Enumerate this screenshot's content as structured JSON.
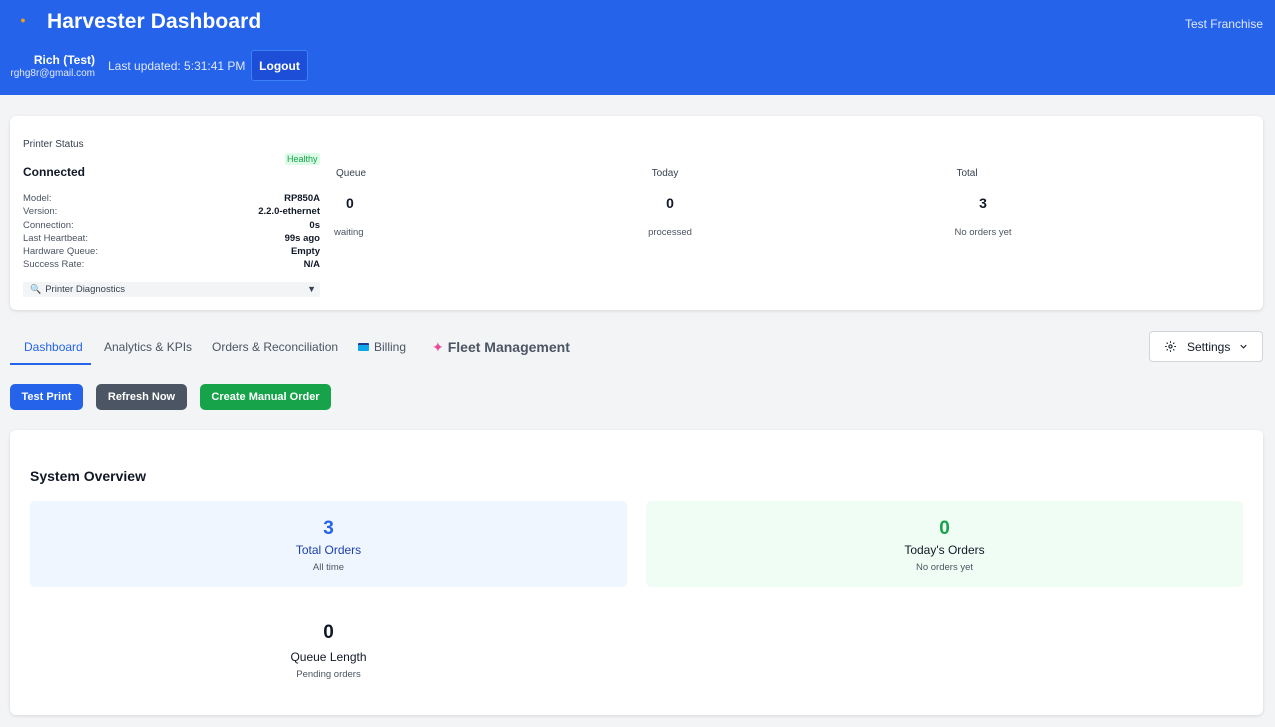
{
  "header": {
    "title": "Harvester Dashboard",
    "franchise": "Test Franchise",
    "user_name": "Rich (Test)",
    "user_email": "rghg8r@gmail.com",
    "last_updated": "Last updated: 5:31:41 PM",
    "logout_label": "Logout",
    "accent_color": "#2563eb"
  },
  "printer": {
    "title": "Printer Status",
    "badge": "Healthy",
    "state": "Connected",
    "rows": [
      {
        "key": "Model:",
        "value": "RP850A"
      },
      {
        "key": "Version:",
        "value": "2.2.0-ethernet"
      },
      {
        "key": "Connection:",
        "value": "0s"
      },
      {
        "key": "Last Heartbeat:",
        "value": "99s ago"
      },
      {
        "key": "Hardware Queue:",
        "value": "Empty"
      },
      {
        "key": "Success Rate:",
        "value": "N/A"
      }
    ],
    "diagnostics_label": "Printer Diagnostics",
    "stats": [
      {
        "label": "Queue",
        "value": "0",
        "sub": "waiting"
      },
      {
        "label": "Today",
        "value": "0",
        "sub": "processed"
      },
      {
        "label": "Total",
        "value": "3",
        "sub": "No orders yet"
      }
    ]
  },
  "tabs": [
    {
      "label": "Dashboard",
      "active": true
    },
    {
      "label": "Analytics & KPIs"
    },
    {
      "label": "Orders & Reconciliation"
    },
    {
      "label": "Billing",
      "icon": "credit-card-icon"
    },
    {
      "label": "Fleet Management",
      "icon": "rocket-icon"
    }
  ],
  "settings_label": "Settings",
  "actions": {
    "test_print": "Test Print",
    "refresh": "Refresh Now",
    "create_order": "Create Manual Order"
  },
  "overview": {
    "title": "System Overview",
    "total": {
      "value": "3",
      "label": "Total Orders",
      "sub": "All time"
    },
    "today": {
      "value": "0",
      "label": "Today's Orders",
      "sub": "No orders yet"
    },
    "queue": {
      "value": "0",
      "label": "Queue Length",
      "sub": "Pending orders"
    }
  }
}
